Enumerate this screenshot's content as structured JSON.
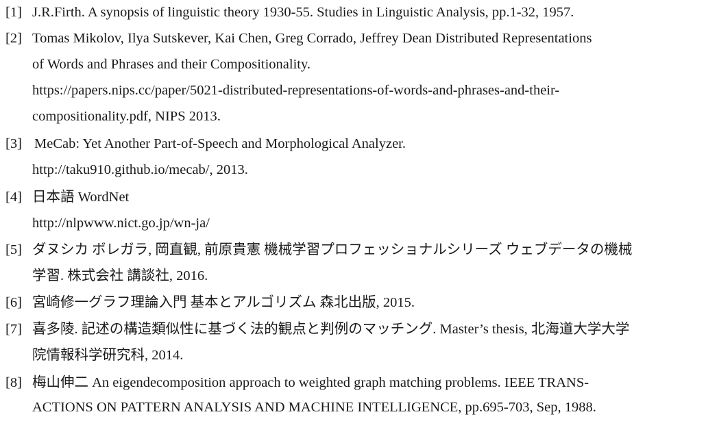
{
  "references": [
    {
      "num": "[1]",
      "lines": [
        "J.R.Firth. A synopsis of linguistic theory 1930-55. Studies in Linguistic Analysis, pp.1-32, 1957."
      ]
    },
    {
      "num": "[2]",
      "lines": [
        "Tomas Mikolov, Ilya Sutskever, Kai Chen, Greg Corrado, Jeffrey Dean Distributed Representations",
        "of Words and Phrases and their Compositionality.",
        "https://papers.nips.cc/paper/5021-distributed-representations-of-words-and-phrases-and-their-",
        "compositionality.pdf, NIPS 2013."
      ]
    },
    {
      "num": "[3]",
      "lines": [
        "MeCab: Yet Another Part-of-Speech and Morphological Analyzer.",
        "http://taku910.github.io/mecab/, 2013."
      ]
    },
    {
      "num": "[4]",
      "lines": [
        "日本語 WordNet",
        "http://nlpwww.nict.go.jp/wn-ja/"
      ]
    },
    {
      "num": "[5]",
      "lines": [
        "ダヌシカ ボレガラ, 岡直観, 前原貴憲 機械学習プロフェッショナルシリーズ ウェブデータの機械",
        "学習. 株式会社 講談社, 2016."
      ]
    },
    {
      "num": "[6]",
      "lines": [
        "宮崎修一グラフ理論入門 基本とアルゴリズム 森北出版, 2015."
      ]
    },
    {
      "num": "[7]",
      "lines": [
        "喜多陵. 記述の構造類似性に基づく法的観点と判例のマッチング. Master’s thesis, 北海道大学大学",
        "院情報科学研究科, 2014."
      ]
    },
    {
      "num": "[8]",
      "lines": [
        "梅山伸二 An eigendecomposition approach to weighted graph matching problems. IEEE TRANS-",
        "ACTIONS ON PATTERN ANALYSIS AND MACHINE INTELLIGENCE, pp.695-703, Sep, 1988."
      ]
    }
  ]
}
